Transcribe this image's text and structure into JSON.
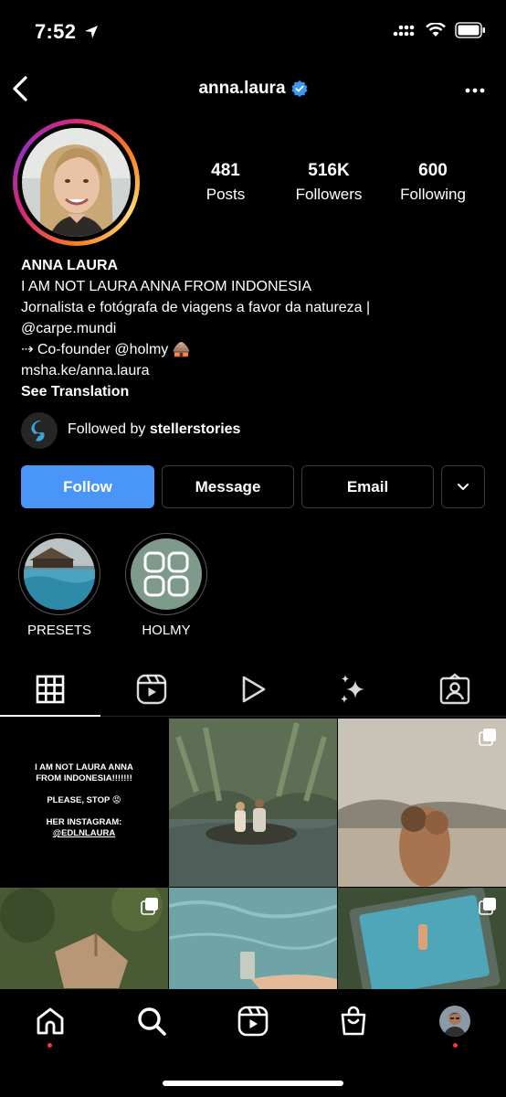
{
  "status_bar": {
    "time": "7:52"
  },
  "header": {
    "username": "anna.laura",
    "verified": true
  },
  "stats": [
    {
      "value": "481",
      "label": "Posts"
    },
    {
      "value": "516K",
      "label": "Followers"
    },
    {
      "value": "600",
      "label": "Following"
    }
  ],
  "bio": {
    "name": "ANNA LAURA",
    "line1": "I AM NOT LAURA ANNA FROM INDONESIA",
    "line2": "Jornalista e fotógrafa de viagens a favor da natureza |",
    "line3": "@carpe.mundi",
    "line4": "⇢ Co-founder @holmy 🛖",
    "link": "msha.ke/anna.laura",
    "translation": "See Translation"
  },
  "followed_by": {
    "prefix": "Followed by ",
    "user": "stellerstories"
  },
  "buttons": {
    "follow": "Follow",
    "message": "Message",
    "email": "Email"
  },
  "highlights": [
    {
      "label": "PRESETS"
    },
    {
      "label": "HOLMY"
    }
  ],
  "grid_post_text": {
    "line1": "I AM NOT LAURA ANNA",
    "line2": "FROM INDONESIA!!!!!!!",
    "line3": "PLEASE, STOP 😡",
    "line4": "HER INSTAGRAM:",
    "line5": "@EDLNLAURA"
  },
  "colors": {
    "accent": "#4a96f8",
    "verified": "#3897f0",
    "notification": "#ff3040"
  },
  "icons": [
    "back-icon",
    "verified-icon",
    "more-icon",
    "grid-icon",
    "reels-icon",
    "video-icon",
    "effects-icon",
    "tagged-icon",
    "home-icon",
    "search-icon",
    "shop-icon",
    "profile-icon"
  ]
}
